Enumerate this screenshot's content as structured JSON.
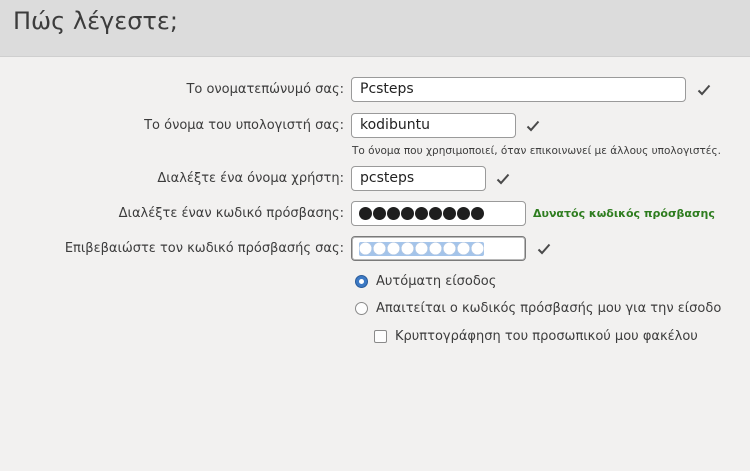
{
  "header": {
    "title": "Πώς λέγεστε;"
  },
  "form": {
    "fullname": {
      "label": "Το ονοματεπώνυμό σας:",
      "value": "Pcsteps",
      "valid_icon": "checkmark-icon"
    },
    "computer_name": {
      "label": "Το όνομα του υπολογιστή σας:",
      "value": "kodibuntu",
      "valid_icon": "checkmark-icon",
      "hint": "Το όνομα που χρησιμοποιεί, όταν επικοινωνεί με άλλους υπολογιστές."
    },
    "username": {
      "label": "Διαλέξτε ένα όνομα χρήστη:",
      "value": "pcsteps",
      "valid_icon": "checkmark-icon"
    },
    "password": {
      "label": "Διαλέξτε έναν κωδικό πρόσβασης:",
      "masked_length": 9,
      "strength": "Δυνατός κωδικός πρόσβασης"
    },
    "confirm_password": {
      "label": "Επιβεβαιώστε τον κωδικό πρόσβασής σας:",
      "masked_length": 9,
      "valid_icon": "checkmark-icon"
    }
  },
  "login_options": {
    "auto_login": {
      "label": "Αυτόματη είσοδος",
      "selected": true
    },
    "require_password": {
      "label": "Απαιτείται ο κωδικός πρόσβασής μου για την είσοδο",
      "selected": false
    },
    "encrypt_home": {
      "label": "Κρυπτογράφηση του προσωπικού μου φακέλου",
      "checked": false
    }
  },
  "colors": {
    "header_bg": "#dcdcdc",
    "body_bg": "#f2f1f0",
    "strength_green": "#2e7d1f",
    "radio_selected": "#3c79c4",
    "selection": "#a4c4ea"
  }
}
